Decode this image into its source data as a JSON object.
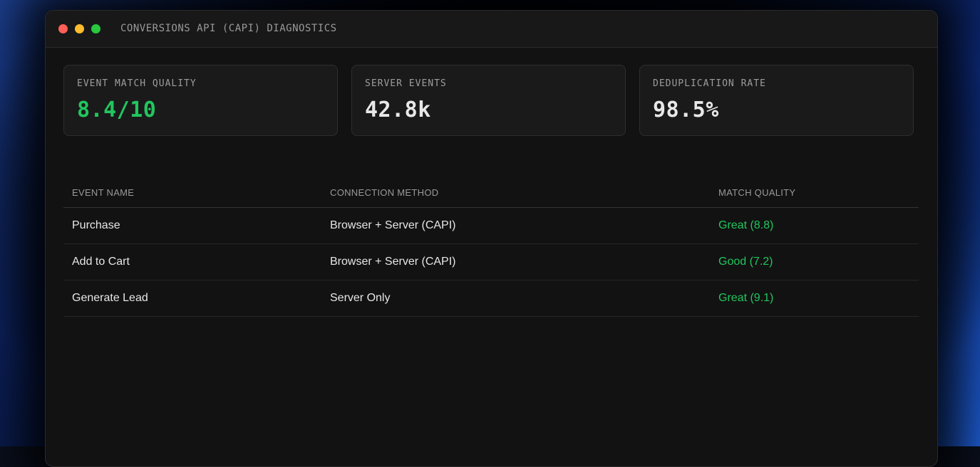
{
  "window": {
    "title": "CONVERSIONS API (CAPI) DIAGNOSTICS"
  },
  "metrics": [
    {
      "label": "EVENT MATCH QUALITY",
      "value": "8.4/10",
      "accent": true
    },
    {
      "label": "SERVER EVENTS",
      "value": "42.8k",
      "accent": false
    },
    {
      "label": "DEDUPLICATION RATE",
      "value": "98.5%",
      "accent": false
    }
  ],
  "table": {
    "headers": [
      "EVENT NAME",
      "CONNECTION METHOD",
      "MATCH QUALITY"
    ],
    "rows": [
      {
        "event": "Purchase",
        "method": "Browser + Server (CAPI)",
        "quality": "Great (8.8)"
      },
      {
        "event": "Add to Cart",
        "method": "Browser + Server (CAPI)",
        "quality": "Good (7.2)"
      },
      {
        "event": "Generate Lead",
        "method": "Server Only",
        "quality": "Great (9.1)"
      }
    ]
  },
  "colors": {
    "accent": "#22c55e",
    "close": "#ff5f57",
    "minimize": "#febc2e",
    "maximize": "#28c840"
  }
}
